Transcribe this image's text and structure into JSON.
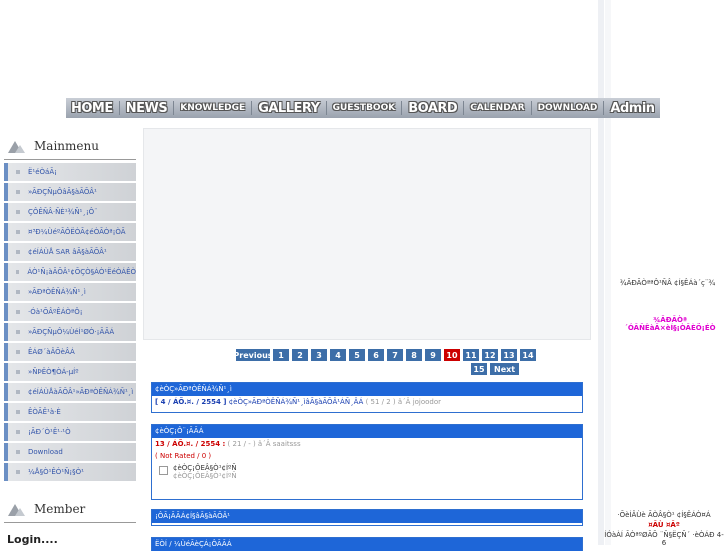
{
  "nav": {
    "items": [
      "HOME",
      "NEWS",
      "KNOWLEDGE",
      "GALLERY",
      "GUESTBOOK",
      "BOARD",
      "CALENDAR",
      "DOWNLOAD",
      "Admin"
    ]
  },
  "sidebar": {
    "mainmenu_title": "Mainmenu",
    "member_title": "Member",
    "login_label": "Login....",
    "items": [
      "Ë¹éÒáÃ¡",
      "»ÃÐÇÑµÔâÃ§àÃÕÂ¹",
      "ÇÔÊÑÂ·ÑÈ¹¾Ñ¹¸¡Ô¨",
      "¤³Ð¼ÙéºÃÔËÒÃ¢éÒÃÒª¡ÒÃ",
      "¢éÍÁÙÅ SAR âÃ§àÃÕÂ¹",
      "ÁÒ¹Ñ¡àÃÕÂ¹¢ÕÇÒ§ÁÒ¹ËéÒÁÊÒ",
      "»ÃÐªÒÊÑÁ¾Ñ¹¸ì",
      "·Óà¹ÕÂºÊÁÒªÔ¡",
      "»ÃÐÇÑµÔ¼ÙéÍ¹ØÒ·¡ÃÃÁ",
      "ÊÁØ´àÂÕèÂÁ",
      "»ÑÞËÒ¶ÒÁ-µÍº",
      "¢éÍÁÙÅàÃÕÂ¹»ÃÐªÒÊÑÁ¾Ñ¹¸ì",
      "ÊÒÃÊ¹à·È",
      "¡ÃÐ´Ò¹Ê¹·¹Ò",
      "Download",
      "¼Å§Ò¹ÊÓ¹Ñ¡§Ò¹"
    ]
  },
  "pager": {
    "prev_label": "Previous",
    "next_label": "Next",
    "pages": [
      "1",
      "2",
      "3",
      "4",
      "5",
      "6",
      "7",
      "8",
      "9",
      "10",
      "11",
      "12",
      "13",
      "14",
      "15"
    ],
    "current": "10"
  },
  "board1": {
    "title": "¢èÒÇ»ÃÐªÒÊÑÁ¾Ñ¹¸ì",
    "date": "[ 4 / ÁÕ.¤. / 2554 ]",
    "subject": "¢èÒÇ»ÃÐªÒÊÑÁ¾Ñ¹¸ìâÃ§àÃÕÂ¹ÁÑ¸ÂÁ",
    "meta": "( 51 / 2 ) â´Â jojoodor"
  },
  "board2": {
    "title": "¢èÒÇ¡Ô¨¡ÃÃÁ",
    "date": "13 / ÁÕ.¤. / 2554 :",
    "meta": "( 21 / - ) â´Â saaitsss",
    "rating": "( Not Rated / 0 )",
    "item_title": "¢èÒÇ¡ÔEÂ§Ò¹¢ÍºÑ",
    "item_sub": "¢èÒÇ¡ÔEÂ§Ò¹¢ÍºÑ"
  },
  "board3": {
    "title": "¡ÔÃ¡ÃÃÁ¢Í§âÃ§àÃÕÂ¹"
  },
  "board4": {
    "title": "ËÒÍ / ¼ÙéÃèÇÁ¡ÔÃÃÁ"
  },
  "right": {
    "text1": "¾ÃÐÃÒªªÔ¹ÑÂ ¢Í§ÊÁà´ç¨¾",
    "text2": "¾ÃÐÃÒª´ÓÃÑÊàÃ×èÍ§¡ÒÃÈÖ¡ÉÒ",
    "text3a": "·ÕèÍÂÙè ÃÒÂ§Ò¹ ¢Í§ÊÁÒ¤Á",
    "text3b": "¤ÃÙ ¤Ãº",
    "text3c": "ÍÓàÀÍ ÃÒªºØÃÕ ¨Ñ§ËÇÑ´ ·èÒÁÐ 4-6"
  },
  "colors": {
    "board_header": "#1e66d8",
    "pager": "#3d6ea8",
    "pager_current": "#cc0000",
    "magenta_text": "#e000d0"
  }
}
